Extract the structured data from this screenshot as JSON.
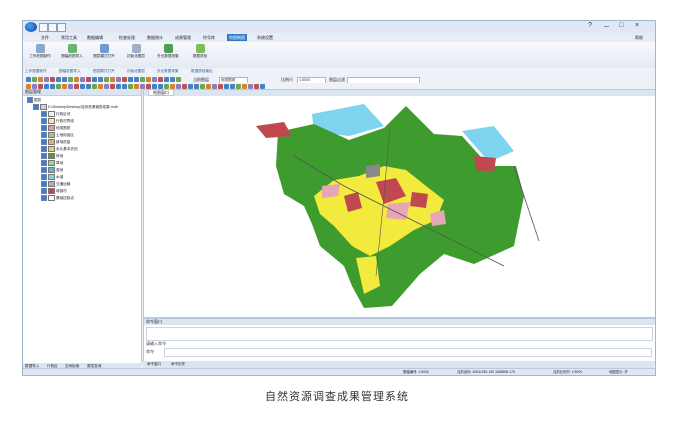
{
  "app": {
    "menu": [
      "文件",
      "常用工具",
      "数据编辑",
      "检查处理",
      "数据统计",
      "成果管理",
      "符号库",
      "地图制图",
      "系统设置"
    ],
    "menu_active_index": 7,
    "window_controls": [
      "?",
      "－",
      "□",
      "×"
    ],
    "user": "帮助",
    "ribbon_buttons": [
      "工作底图制作",
      "图幅底图导入",
      "图层模式打开",
      "初始化图层",
      "外业数据采集",
      "数据质检"
    ],
    "ribbon_row2": [
      "工作底图制作",
      "图幅底图导入",
      "图层模式打开",
      "初始化图层",
      "外业数据采集",
      "数据质检输出"
    ],
    "toolbar2": {
      "label1": "比例尺",
      "scale": "1:5000",
      "label2": "图层过滤",
      "label3": "当前图层",
      "layer": "地类图斑"
    }
  },
  "layer_panel": {
    "title": "图层管理",
    "root": "图层",
    "db": "D:\\Desktop\\Desktop\\自然资源调查成果.mdb",
    "layers": [
      "行政区划",
      "行政村界线",
      "地类图斑",
      "土地用途区",
      "耕地质量",
      "永久基本农田",
      "林地",
      "草地",
      "湿地",
      "水域",
      "交通运输",
      "城镇村",
      "基础控制点"
    ],
    "bottom_tabs": [
      "数据导入",
      "行政区",
      "空间检索",
      "属性查询"
    ]
  },
  "map": {
    "tab": "地图窗口",
    "colors": {
      "green": "#3e9c2e",
      "yellow": "#f2ea3c",
      "red": "#c0484f",
      "pink": "#e7a6b6",
      "blue": "#7ed3ee",
      "gray": "#888888"
    }
  },
  "command": {
    "title": "命令窗口",
    "line1": "请输入命令:",
    "line2": "命令:",
    "tabs": [
      "命令窗口",
      "命令历史"
    ]
  },
  "status": {
    "items": [
      "图幅编号: 1:5000",
      "当前坐标: 40541951.150  3468596.170",
      "当前比例尺: 1:5000",
      "地图显示: 开"
    ]
  },
  "caption": "自然资源调查成果管理系统"
}
